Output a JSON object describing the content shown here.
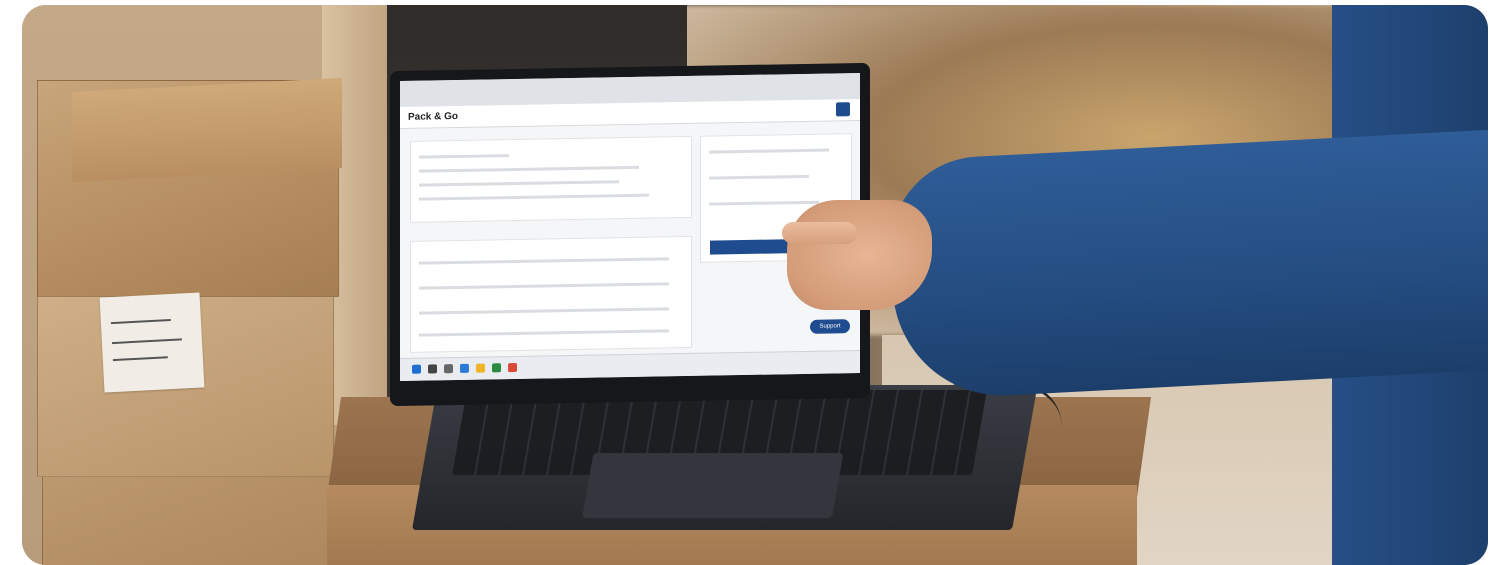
{
  "laptop_screen": {
    "app_title": "Pack & Go",
    "support_label": "Support"
  },
  "colors": {
    "accent_blue": "#1f4c8f",
    "sleeve_blue": "#2f5d98",
    "cardboard": "#c8a57b",
    "table_wood": "#9c7450"
  }
}
